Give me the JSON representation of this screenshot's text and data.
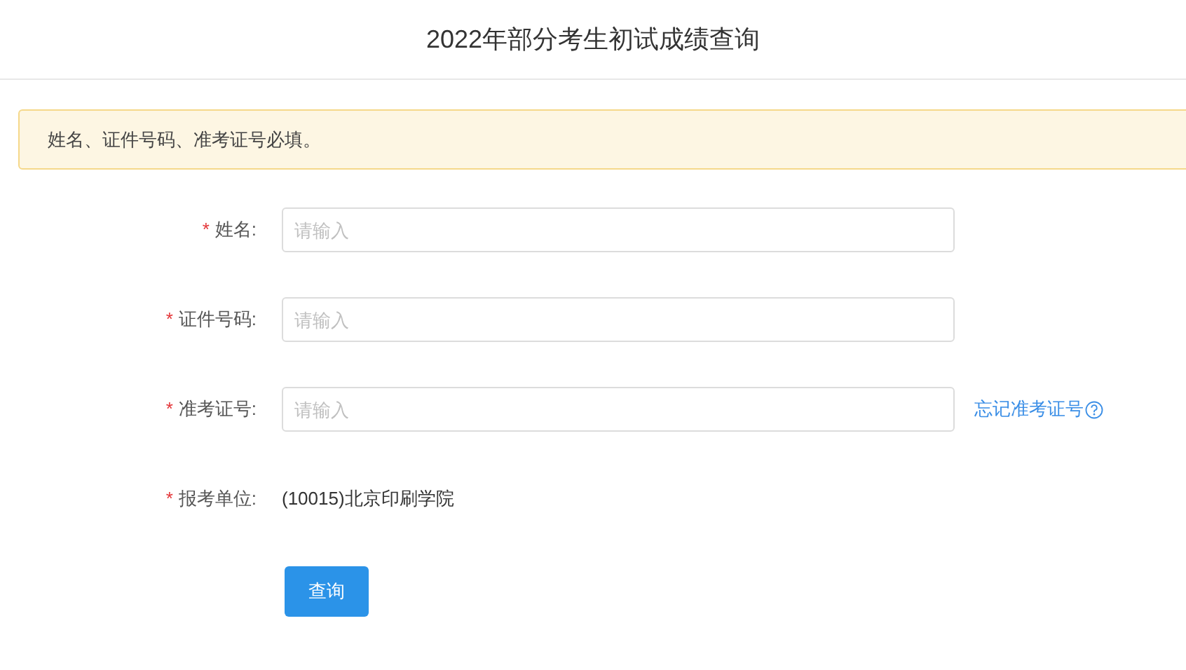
{
  "header": {
    "title": "2022年部分考生初试成绩查询"
  },
  "notice": {
    "text": "姓名、证件号码、准考证号必填。"
  },
  "fields": [
    {
      "kind": "input",
      "required_mark": "*",
      "label": "姓名:",
      "placeholder": "请输入"
    },
    {
      "kind": "input",
      "required_mark": "*",
      "label": "证件号码:",
      "placeholder": "请输入"
    },
    {
      "kind": "input",
      "required_mark": "*",
      "label": "准考证号:",
      "placeholder": "请输入",
      "link": "忘记准考证号"
    },
    {
      "kind": "text",
      "required_mark": "*",
      "label": "报考单位:",
      "value": "(10015)北京印刷学院"
    }
  ],
  "submit": {
    "label": "查询"
  }
}
